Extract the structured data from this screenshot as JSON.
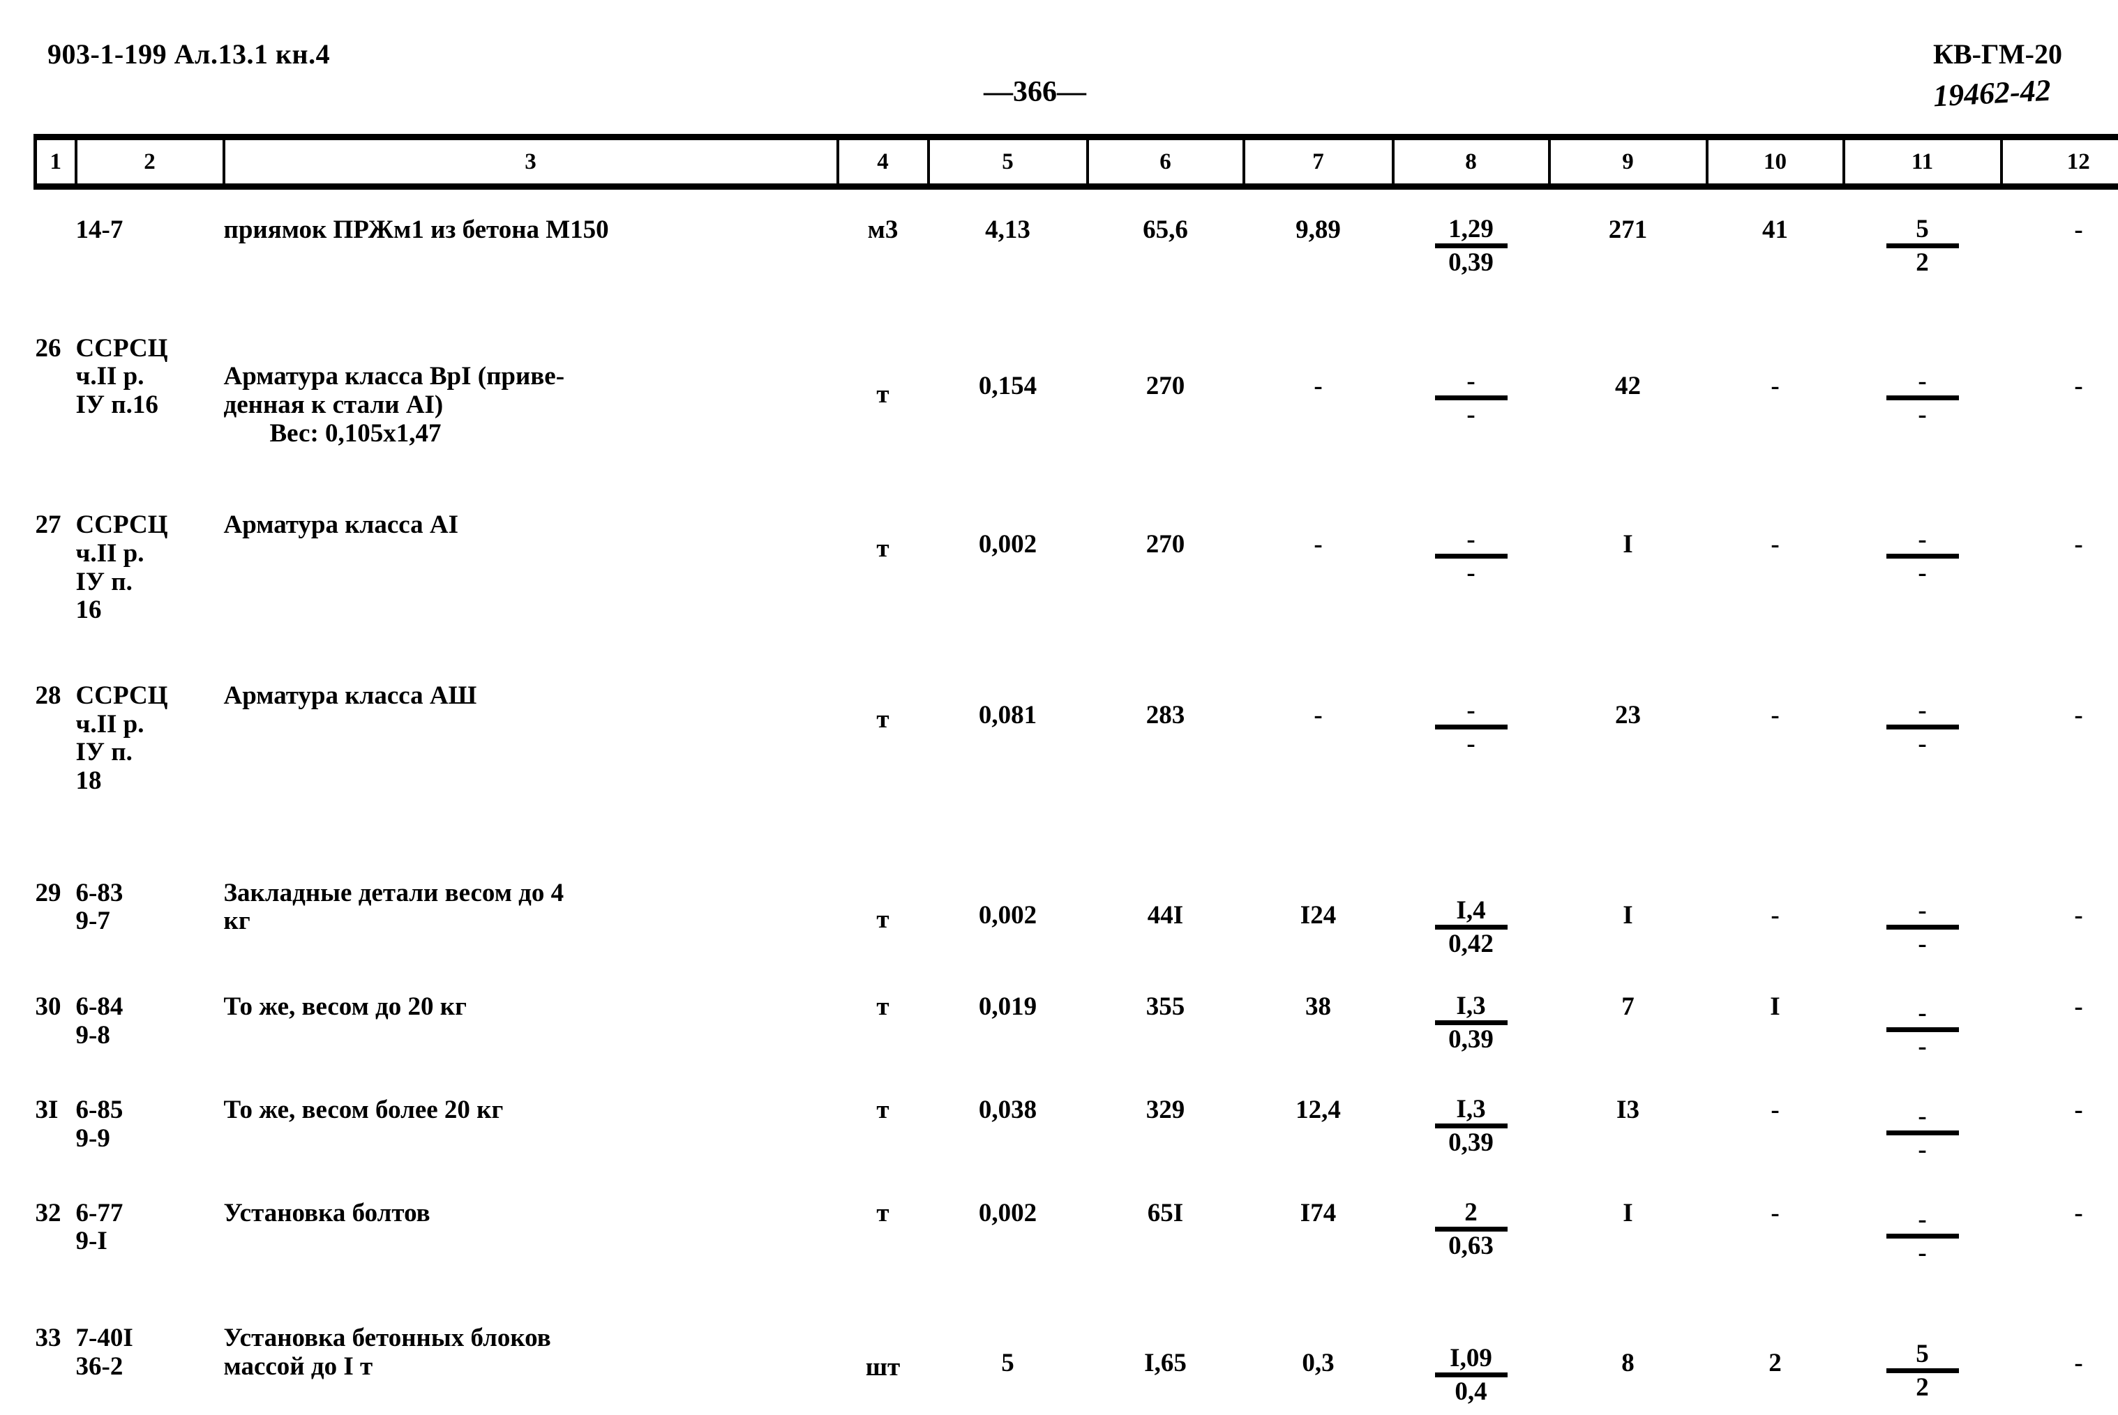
{
  "header": {
    "doc_code": "903-1-199 Ал.13.1 кн.4",
    "page_number": "—366—",
    "sheet_code": "КВ-ГМ-20",
    "hand_code": "19462-42"
  },
  "table": {
    "column_numbers": [
      "1",
      "2",
      "3",
      "4",
      "5",
      "6",
      "7",
      "8",
      "9",
      "10",
      "11",
      "12"
    ],
    "rows": [
      {
        "pos": "",
        "just": "14-7",
        "desc": "приямок ПРЖм1 из бетона М150",
        "unit": "м3",
        "c5": "4,13",
        "c6": "65,6",
        "c7": "9,89",
        "c8_num": "1,29",
        "c8_den": "0,39",
        "c9": "271",
        "c10": "41",
        "c11_num": "5",
        "c11_den": "2",
        "c12": "-"
      },
      {
        "pos": "26",
        "just": "ССРСЦ\nч.II р.\nIУ п.16",
        "desc": "Арматура класса ВрI (приве-\nденная к стали АI)",
        "desc_note": "Вес: 0,105х1,47",
        "unit": "т",
        "c5": "0,154",
        "c6": "270",
        "c7": "-",
        "c8_num": "-",
        "c8_den": "-",
        "c9": "42",
        "c10": "-",
        "c11_num": "-",
        "c11_den": "-",
        "c12": "-"
      },
      {
        "pos": "27",
        "just": "ССРСЦ\nч.II р.\nIУ п.\n16",
        "desc": "Арматура класса АI",
        "desc_note": "",
        "unit": "т",
        "c5": "0,002",
        "c6": "270",
        "c7": "-",
        "c8_num": "-",
        "c8_den": "-",
        "c9": "I",
        "c10": "-",
        "c11_num": "-",
        "c11_den": "-",
        "c12": "-"
      },
      {
        "pos": "28",
        "just": "ССРСЦ\nч.II р.\nIУ п.\n18",
        "desc": "Арматура класса АШ",
        "desc_note": "",
        "unit": "т",
        "c5": "0,081",
        "c6": "283",
        "c7": "-",
        "c8_num": "-",
        "c8_den": "-",
        "c9": "23",
        "c10": "-",
        "c11_num": "-",
        "c11_den": "-",
        "c12": "-"
      },
      {
        "pos": "29",
        "just": "6-83\n9-7",
        "desc": "Закладные детали весом до 4\nкг",
        "desc_note": "",
        "unit": "т",
        "c5": "0,002",
        "c6": "44I",
        "c7": "I24",
        "c8_num": "I,4",
        "c8_den": "0,42",
        "c9": "I",
        "c10": "-",
        "c11_num": "-",
        "c11_den": "-",
        "c12": "-"
      },
      {
        "pos": "30",
        "just": "6-84\n9-8",
        "desc": "То же, весом до 20 кг",
        "desc_note": "",
        "unit": "т",
        "c5": "0,019",
        "c6": "355",
        "c7": "38",
        "c8_num": "I,3",
        "c8_den": "0,39",
        "c9": "7",
        "c10": "I",
        "c11_num": "-",
        "c11_den": "-",
        "c12": "-"
      },
      {
        "pos": "3I",
        "just": "6-85\n9-9",
        "desc": "То же, весом более 20 кг",
        "desc_note": "",
        "unit": "т",
        "c5": "0,038",
        "c6": "329",
        "c7": "12,4",
        "c8_num": "I,3",
        "c8_den": "0,39",
        "c9": "I3",
        "c10": "-",
        "c11_num": "-",
        "c11_den": "-",
        "c12": "-"
      },
      {
        "pos": "32",
        "just": "6-77\n9-I",
        "desc": "Установка   болтов",
        "desc_note": "",
        "unit": "т",
        "c5": "0,002",
        "c6": "65I",
        "c7": "I74",
        "c8_num": "2",
        "c8_den": "0,63",
        "c9": "I",
        "c10": "-",
        "c11_num": "-",
        "c11_den": "-",
        "c12": "-"
      },
      {
        "pos": "33",
        "just": "7-40I\n36-2",
        "desc": "Установка бетонных блоков\nмассой до I т",
        "desc_note": "",
        "unit": "шт",
        "c5": "5",
        "c6": "I,65",
        "c7": "0,3",
        "c8_num": "I,09",
        "c8_den": "0,4",
        "c9": "8",
        "c10": "2",
        "c11_num": "5",
        "c11_den": "2",
        "c12": "-"
      }
    ]
  }
}
